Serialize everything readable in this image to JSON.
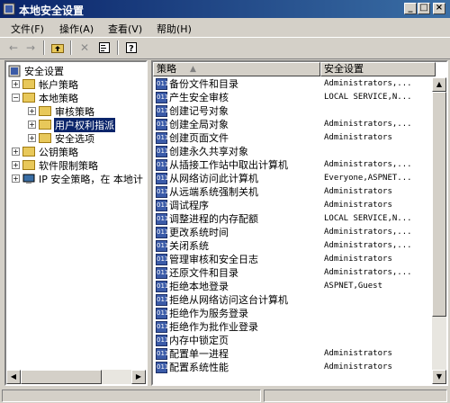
{
  "window": {
    "title": "本地安全设置",
    "min": "_",
    "max": "□",
    "close": "×"
  },
  "menu": [
    "文件(F)",
    "操作(A)",
    "查看(V)",
    "帮助(H)"
  ],
  "tree": {
    "items": [
      {
        "label": "安全设置",
        "level": 0
      },
      {
        "label": "帐户策略",
        "level": 1
      },
      {
        "label": "本地策略",
        "level": 1
      },
      {
        "label": "审核策略",
        "level": 2
      },
      {
        "label": "用户权利指派",
        "level": 2,
        "selected": true
      },
      {
        "label": "安全选项",
        "level": 2
      },
      {
        "label": "公钥策略",
        "level": 1
      },
      {
        "label": "软件限制策略",
        "level": 1
      },
      {
        "label": "IP 安全策略，在 本地计",
        "level": 1
      }
    ]
  },
  "list": {
    "columns": [
      "策略",
      "安全设置"
    ],
    "rows": [
      {
        "policy": "备份文件和目录",
        "setting": "Administrators,..."
      },
      {
        "policy": "产生安全审核",
        "setting": "LOCAL SERVICE,N..."
      },
      {
        "policy": "创建记号对象",
        "setting": ""
      },
      {
        "policy": "创建全局对象",
        "setting": "Administrators,..."
      },
      {
        "policy": "创建页面文件",
        "setting": "Administrators"
      },
      {
        "policy": "创建永久共享对象",
        "setting": ""
      },
      {
        "policy": "从插接工作站中取出计算机",
        "setting": "Administrators,..."
      },
      {
        "policy": "从网络访问此计算机",
        "setting": "Everyone,ASPNET..."
      },
      {
        "policy": "从远端系统强制关机",
        "setting": "Administrators"
      },
      {
        "policy": "调试程序",
        "setting": "Administrators"
      },
      {
        "policy": "调整进程的内存配额",
        "setting": "LOCAL SERVICE,N..."
      },
      {
        "policy": "更改系统时间",
        "setting": "Administrators,..."
      },
      {
        "policy": "关闭系统",
        "setting": "Administrators,..."
      },
      {
        "policy": "管理审核和安全日志",
        "setting": "Administrators"
      },
      {
        "policy": "还原文件和目录",
        "setting": "Administrators,..."
      },
      {
        "policy": "拒绝本地登录",
        "setting": "ASPNET,Guest"
      },
      {
        "policy": "拒绝从网络访问这台计算机",
        "setting": ""
      },
      {
        "policy": "拒绝作为服务登录",
        "setting": ""
      },
      {
        "policy": "拒绝作为批作业登录",
        "setting": ""
      },
      {
        "policy": "内存中锁定页",
        "setting": ""
      },
      {
        "policy": "配置单一进程",
        "setting": "Administrators"
      },
      {
        "policy": "配置系统性能",
        "setting": "Administrators"
      }
    ]
  }
}
